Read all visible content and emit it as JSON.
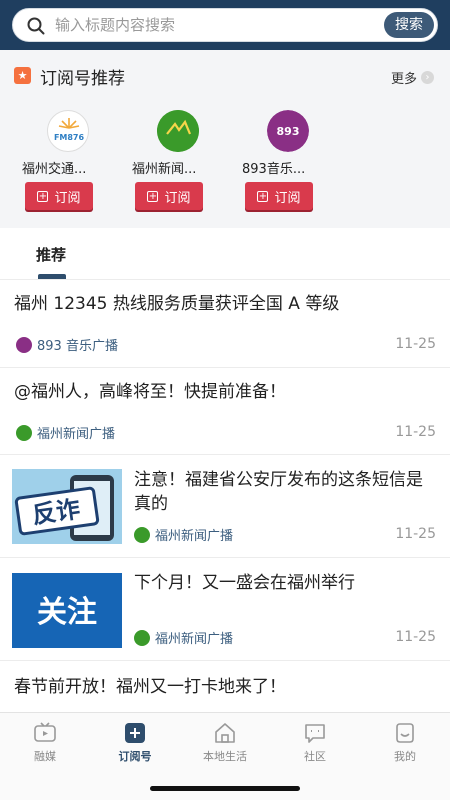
{
  "search": {
    "placeholder": "输入标题内容搜索",
    "button_label": "搜索"
  },
  "subscribe_section": {
    "title": "订阅号推荐",
    "more_label": "更多",
    "channels": [
      {
        "name": "福州交通...",
        "logo_text": "FM876",
        "subscribe_label": "订阅"
      },
      {
        "name": "福州新闻...",
        "logo_text": "",
        "subscribe_label": "订阅"
      },
      {
        "name": "893音乐...",
        "logo_text": "893",
        "subscribe_label": "订阅"
      }
    ]
  },
  "tabs": [
    {
      "label": "推荐",
      "active": true
    }
  ],
  "news": [
    {
      "title": "福州 12345 热线服务质量获评全国 A 等级",
      "source": "893 音乐广播",
      "date": "11-25"
    },
    {
      "title": "@福州人，高峰将至！快提前准备！",
      "source": "福州新闻广播",
      "date": "11-25"
    },
    {
      "title": "注意！福建省公安厅发布的这条短信是真的",
      "source": "福州新闻广播",
      "date": "11-25",
      "thumb_text": "反诈"
    },
    {
      "title": "下个月！又一盛会在福州举行",
      "source": "福州新闻广播",
      "date": "11-25",
      "thumb_text": "关注"
    },
    {
      "title": "春节前开放！福州又一打卡地来了！"
    }
  ],
  "bottom_nav": [
    {
      "label": "融媒",
      "icon": "tv-icon",
      "active": false
    },
    {
      "label": "订阅号",
      "icon": "plus-square-icon",
      "active": true
    },
    {
      "label": "本地生活",
      "icon": "home-icon",
      "active": false
    },
    {
      "label": "社区",
      "icon": "chat-icon",
      "active": false
    },
    {
      "label": "我的",
      "icon": "smile-icon",
      "active": false
    }
  ],
  "colors": {
    "header": "#1f3e5f",
    "accent": "#2e4d6c",
    "subscribe": "#d93a4c",
    "source_text": "#3c5e7f"
  }
}
